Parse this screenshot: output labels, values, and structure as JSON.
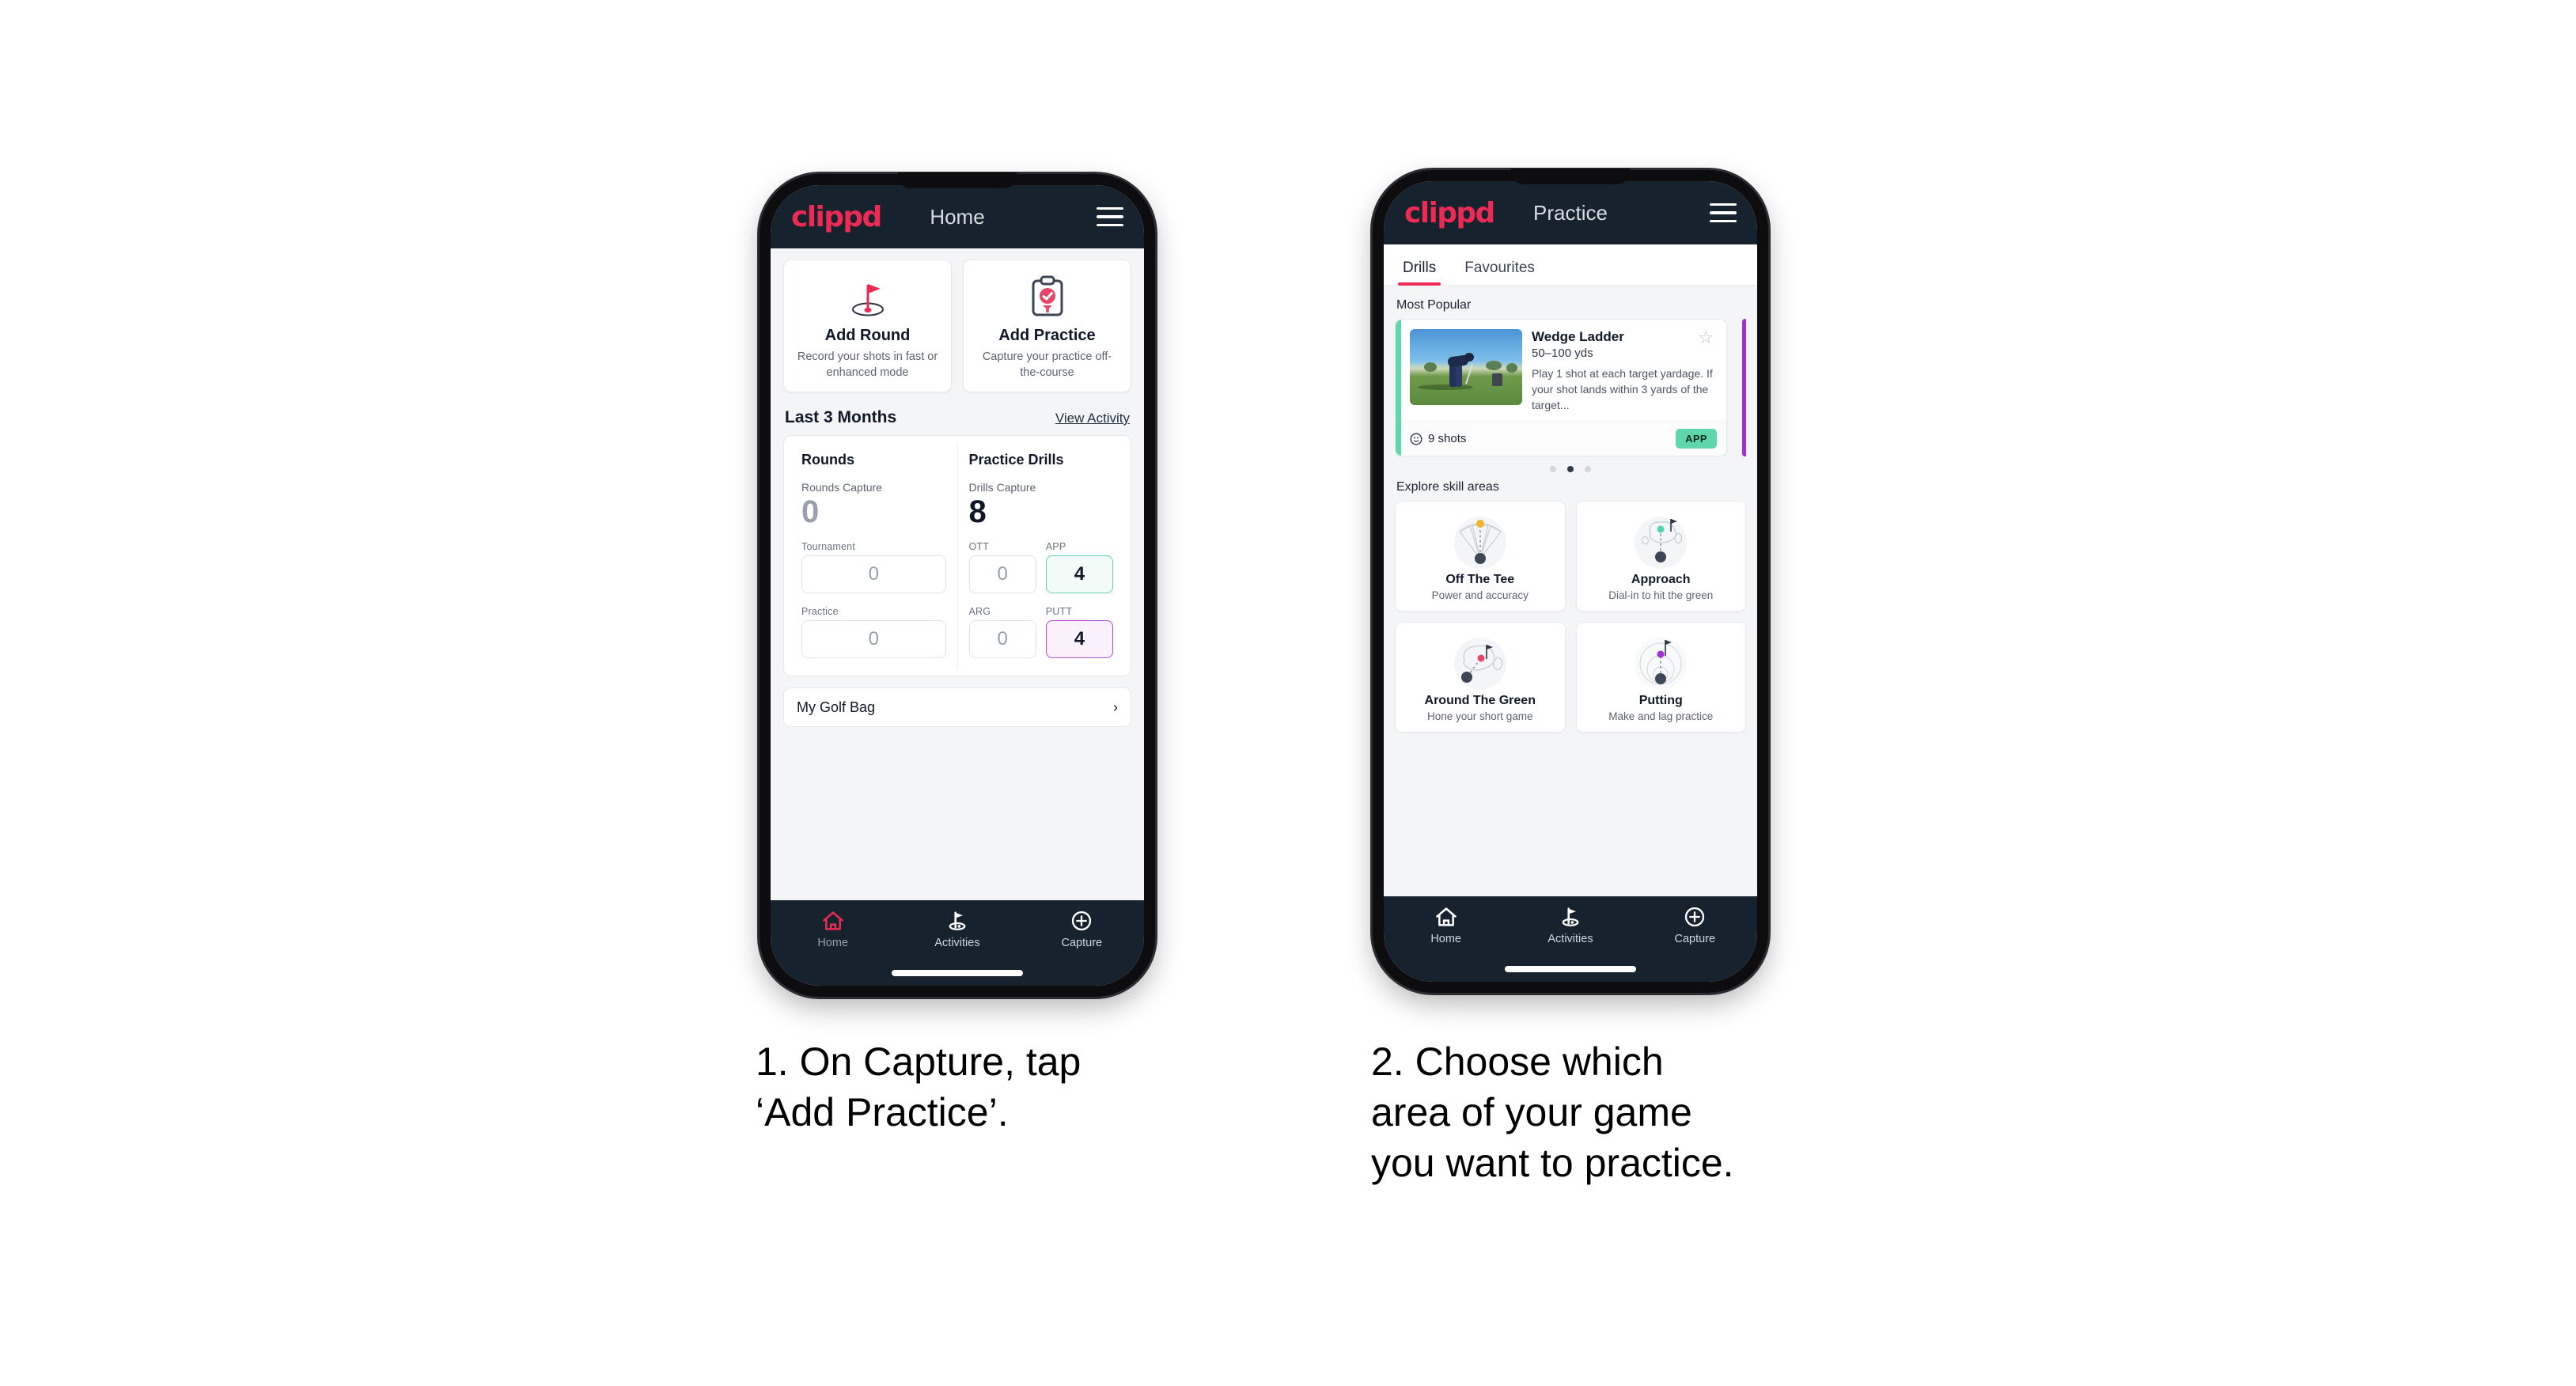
{
  "phone1": {
    "appbar": {
      "logo": "clippd",
      "title": "Home",
      "menu_icon": "hamburger-icon"
    },
    "actions": [
      {
        "icon": "golf-flag-icon",
        "title": "Add Round",
        "subtitle": "Record your shots in fast or enhanced mode"
      },
      {
        "icon": "clipboard-check-icon",
        "title": "Add Practice",
        "subtitle": "Capture your practice off-the-course"
      }
    ],
    "section": {
      "title": "Last 3 Months",
      "link": "View Activity"
    },
    "rounds": {
      "heading": "Rounds",
      "capture_label": "Rounds Capture",
      "capture_value": "0",
      "metrics": [
        {
          "label": "Tournament",
          "value": "0",
          "state": "empty"
        },
        {
          "label": "Practice",
          "value": "0",
          "state": "empty"
        }
      ]
    },
    "drills": {
      "heading": "Practice Drills",
      "capture_label": "Drills Capture",
      "capture_value": "8",
      "metrics": [
        {
          "label": "OTT",
          "value": "0",
          "state": "empty"
        },
        {
          "label": "APP",
          "value": "4",
          "state": "app"
        },
        {
          "label": "ARG",
          "value": "0",
          "state": "empty"
        },
        {
          "label": "PUTT",
          "value": "4",
          "state": "putt"
        }
      ]
    },
    "golf_bag": {
      "label": "My Golf Bag",
      "chevron": "chevron-right-icon"
    },
    "nav": [
      {
        "icon": "home-icon",
        "label": "Home",
        "active": true
      },
      {
        "icon": "golf-flag-icon",
        "label": "Activities",
        "active": false
      },
      {
        "icon": "plus-circle-icon",
        "label": "Capture",
        "active": false
      }
    ]
  },
  "phone2": {
    "appbar": {
      "logo": "clippd",
      "title": "Practice",
      "menu_icon": "hamburger-icon"
    },
    "tabs": [
      {
        "label": "Drills",
        "active": true
      },
      {
        "label": "Favourites",
        "active": false
      }
    ],
    "most_popular_heading": "Most Popular",
    "drill": {
      "title": "Wedge Ladder",
      "yardage": "50–100 yds",
      "description": "Play 1 shot at each target yardage. If your shot lands within 3 yards of the target...",
      "shots": "9 shots",
      "badge": "APP",
      "star_icon": "star-outline-icon",
      "shots_icon": "target-icon",
      "accent_color": "#5fd6ac",
      "next_accent_color": "#a330d6"
    },
    "carousel_dots": {
      "count": 3,
      "active_index": 1
    },
    "explore_heading": "Explore skill areas",
    "skills": [
      {
        "icon": "off-the-tee-icon",
        "name": "Off The Tee",
        "sub": "Power and accuracy",
        "dot_color": "#f0b429"
      },
      {
        "icon": "approach-icon",
        "name": "Approach",
        "sub": "Dial-in to hit the green",
        "dot_color": "#4bd6b5"
      },
      {
        "icon": "around-the-green-icon",
        "name": "Around The Green",
        "sub": "Hone your short game",
        "dot_color": "#e8456b"
      },
      {
        "icon": "putting-icon",
        "name": "Putting",
        "sub": "Make and lag practice",
        "dot_color": "#a330d6"
      }
    ],
    "nav": [
      {
        "icon": "home-icon",
        "label": "Home",
        "active": false
      },
      {
        "icon": "golf-flag-icon",
        "label": "Activities",
        "active": false
      },
      {
        "icon": "plus-circle-icon",
        "label": "Capture",
        "active": false
      }
    ]
  },
  "captions": {
    "step1": "1. On Capture, tap\n‘Add Practice’.",
    "step2": "2. Choose which\narea of your game\nyou want to practice."
  },
  "colors": {
    "brand": "#ec2a53",
    "navbar": "#16222e",
    "app_green": "#5fd6ac",
    "putt_purple": "#a330d6",
    "page_bg": "#ffffff"
  }
}
